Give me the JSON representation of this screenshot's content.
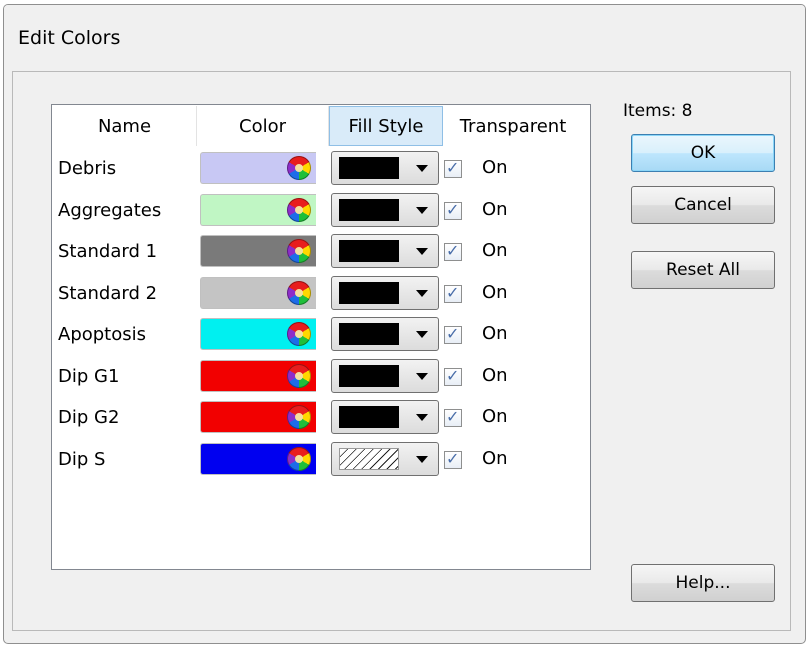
{
  "window": {
    "title": "Edit Colors"
  },
  "table": {
    "headers": [
      "Name",
      "Color",
      "Fill Style",
      "Transparent"
    ],
    "rows": [
      {
        "name": "Debris",
        "color": "#c8c8f4",
        "fill_style": "solid-black",
        "transparent": true,
        "transparent_label": "On"
      },
      {
        "name": "Aggregates",
        "color": "#c0f6c4",
        "fill_style": "solid-black",
        "transparent": true,
        "transparent_label": "On"
      },
      {
        "name": "Standard 1",
        "color": "#7a7a7a",
        "fill_style": "solid-black",
        "transparent": true,
        "transparent_label": "On"
      },
      {
        "name": "Standard 2",
        "color": "#c4c4c4",
        "fill_style": "solid-black",
        "transparent": true,
        "transparent_label": "On"
      },
      {
        "name": "Apoptosis",
        "color": "#00f0f0",
        "fill_style": "solid-black",
        "transparent": true,
        "transparent_label": "On"
      },
      {
        "name": "Dip G1",
        "color": "#f20000",
        "fill_style": "solid-black",
        "transparent": true,
        "transparent_label": "On"
      },
      {
        "name": "Dip G2",
        "color": "#f20000",
        "fill_style": "solid-black",
        "transparent": true,
        "transparent_label": "On"
      },
      {
        "name": "Dip S",
        "color": "#0000f0",
        "fill_style": "diagonal-hatch",
        "transparent": true,
        "transparent_label": "On"
      }
    ]
  },
  "side": {
    "items_count": "Items: 8",
    "ok": "OK",
    "cancel": "Cancel",
    "reset_all": "Reset All",
    "help": "Help..."
  },
  "icons": {
    "color_picker": "color-wheel-icon",
    "dropdown": "chevron-down-icon",
    "checkbox": "checkmark-icon"
  }
}
